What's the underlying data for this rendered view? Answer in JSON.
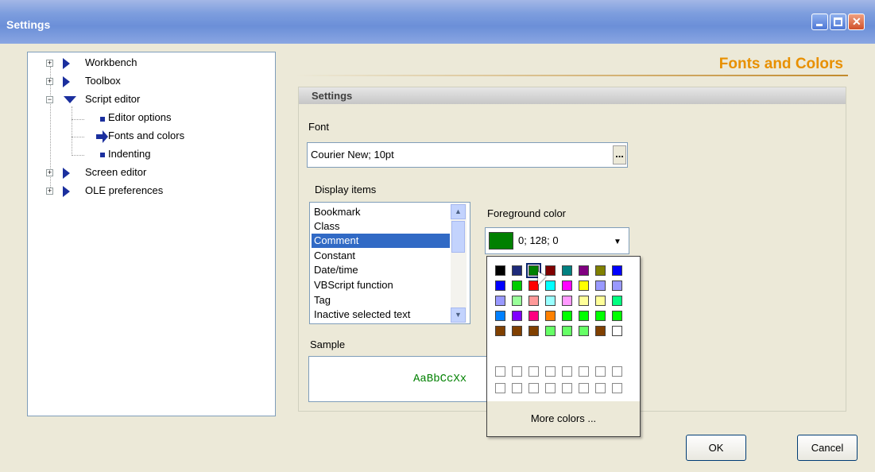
{
  "window": {
    "title": "Settings"
  },
  "tree": {
    "items": [
      {
        "label": "Workbench",
        "expander": "+"
      },
      {
        "label": "Toolbox",
        "expander": "+"
      },
      {
        "label": "Script editor",
        "expander": "−"
      },
      {
        "label": "Editor options"
      },
      {
        "label": "Fonts and colors"
      },
      {
        "label": "Indenting"
      },
      {
        "label": "Screen editor",
        "expander": "+"
      },
      {
        "label": "OLE preferences",
        "expander": "+"
      }
    ]
  },
  "panel": {
    "title": "Fonts and Colors",
    "group_title": "Settings",
    "font_label": "Font",
    "font_value": "Courier New; 10pt",
    "font_button": "...",
    "display_items_label": "Display items",
    "display_items": [
      "Bookmark",
      "Class",
      "Comment",
      "Constant",
      "Date/time",
      "VBScript function",
      "Tag",
      "Inactive selected text"
    ],
    "selected_item": "Comment",
    "foreground_label": "Foreground color",
    "foreground_value": "0; 128; 0",
    "foreground_color": "#008000",
    "sample_label": "Sample",
    "sample_text": "AaBbCcXx"
  },
  "palette": {
    "rows": [
      [
        "#000000",
        "#1e2a7a",
        "#008000",
        "#800000",
        "#008080",
        "#800080",
        "#808000",
        "#0000ff"
      ],
      [
        "#0000ff",
        "#00cc00",
        "#ff0000",
        "#00ffff",
        "#ff00ff",
        "#ffff00",
        "#9999ff",
        "#9999ff"
      ],
      [
        "#9999ff",
        "#99ff99",
        "#ff9999",
        "#99ffff",
        "#ff99ff",
        "#ffff99",
        "#ffff99",
        "#00ff80"
      ],
      [
        "#0080ff",
        "#8000ff",
        "#ff0080",
        "#ff8000",
        "#00ff00",
        "#00ff00",
        "#00ff00",
        "#00ff00"
      ],
      [
        "#804000",
        "#804000",
        "#804000",
        "#66ff66",
        "#66ff66",
        "#66ff66",
        "#804000",
        "#ffffff"
      ]
    ],
    "empty_rows": 2,
    "more_colors_label": "More colors ..."
  },
  "buttons": {
    "ok": "OK",
    "cancel": "Cancel"
  }
}
